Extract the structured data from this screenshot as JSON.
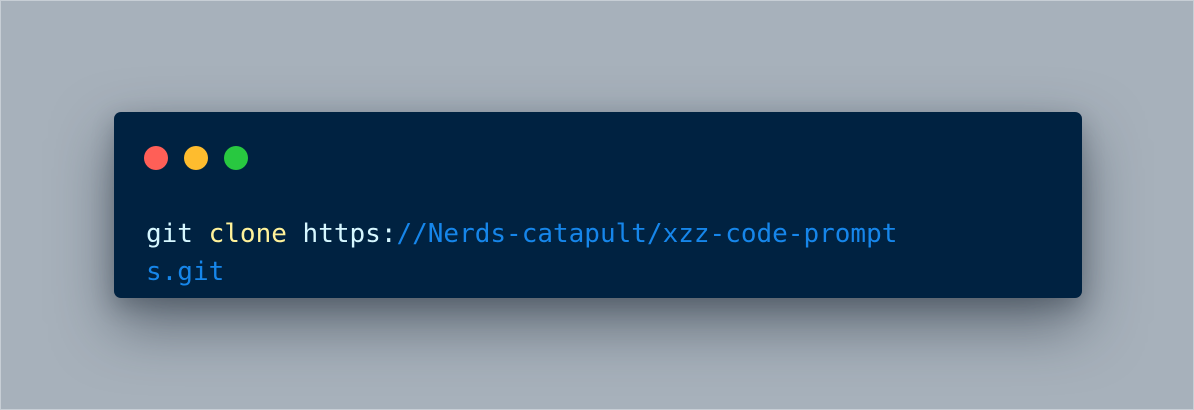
{
  "window": {
    "controls": [
      {
        "name": "close",
        "color": "#ff5f57"
      },
      {
        "name": "minimize",
        "color": "#febc2e"
      },
      {
        "name": "maximize",
        "color": "#28c840"
      }
    ]
  },
  "code": {
    "tokens": [
      {
        "text": "git ",
        "color": "#d6f7ff"
      },
      {
        "text": "clone ",
        "color": "#fff29a"
      },
      {
        "text": "https:",
        "color": "#d6f7ff"
      },
      {
        "text": "//Nerds-catapult/xzz-code-prompts.git",
        "color": "#1686ea"
      }
    ]
  },
  "colors": {
    "background": "#a7b1bb",
    "window": "#002241"
  }
}
